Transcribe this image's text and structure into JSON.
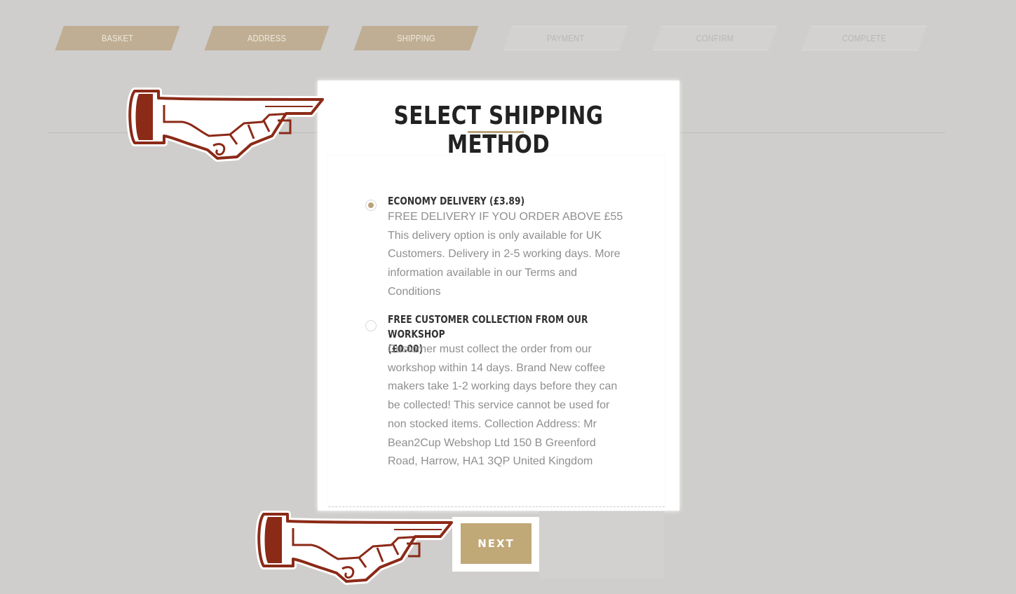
{
  "steps": [
    {
      "label": "BASKET",
      "state": "done"
    },
    {
      "label": "ADDRESS",
      "state": "done"
    },
    {
      "label": "SHIPPING",
      "state": "done"
    },
    {
      "label": "PAYMENT",
      "state": "todo"
    },
    {
      "label": "CONFIRM",
      "state": "todo"
    },
    {
      "label": "COMPLETE",
      "state": "todo"
    }
  ],
  "page_title": "SELECT SHIPPING METHOD",
  "options": [
    {
      "title": "ECONOMY DELIVERY (£3.89)",
      "lines": [
        "FREE DELIVERY IF YOU ORDER ABOVE £55",
        "This delivery option is only available for UK",
        "Customers. Delivery in 2-5 working days. More",
        "information available in our Terms and",
        "Conditions"
      ],
      "selected": true
    },
    {
      "title_lines": [
        "FREE CUSTOMER COLLECTION FROM OUR WORKSHOP",
        "(£0.00)"
      ],
      "lines": [
        "Customer must collect the order from our",
        "workshop within 14 days. Brand New coffee",
        "makers take 1-2 working days before they can",
        "be collected! This service cannot be used for",
        "non stocked items. Collection Address: Mr",
        "Bean2Cup Webshop Ltd 150 B Greenford",
        "Road, Harrow, HA1 3QP United Kingdom"
      ],
      "selected": false
    }
  ],
  "next_label": "NEXT",
  "colors": {
    "accent": "#c1a877",
    "hand": "#8b2a17"
  },
  "icons": [
    "pointing-hand-icon",
    "pointing-hand-icon"
  ]
}
